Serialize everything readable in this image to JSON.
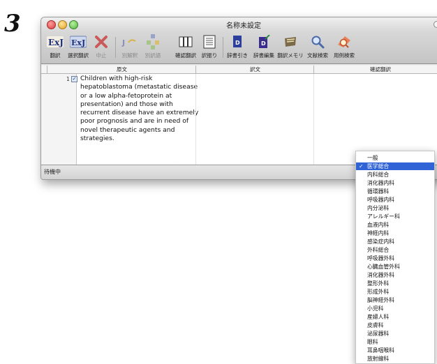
{
  "step_number": "3",
  "window": {
    "title": "名称未設定"
  },
  "toolbar": {
    "buttons": [
      {
        "label": "翻訳",
        "icon": "exj-translate-icon",
        "disabled": false
      },
      {
        "label": "選択翻訳",
        "icon": "exj-select-translate-icon",
        "disabled": false
      },
      {
        "label": "中止",
        "icon": "stop-x-icon",
        "disabled": true
      },
      {
        "label": "別解釈",
        "icon": "alt-interpretation-icon",
        "disabled": true
      },
      {
        "label": "別訳語",
        "icon": "alt-term-icon",
        "disabled": true
      },
      {
        "label": "確認翻訳",
        "icon": "confirm-translate-icon",
        "disabled": false
      },
      {
        "label": "訳振り",
        "icon": "interlinear-icon",
        "disabled": false
      },
      {
        "label": "辞書引き",
        "icon": "dictionary-lookup-icon",
        "disabled": false
      },
      {
        "label": "辞書編集",
        "icon": "dictionary-edit-icon",
        "disabled": false
      },
      {
        "label": "翻訳メモリ",
        "icon": "translation-memory-icon",
        "disabled": false
      },
      {
        "label": "文献検索",
        "icon": "literature-search-icon",
        "disabled": false
      },
      {
        "label": "用例検索",
        "icon": "example-search-icon",
        "disabled": false
      }
    ],
    "overflow": "›"
  },
  "columns": [
    "原文",
    "訳文",
    "確認翻訳"
  ],
  "rows": [
    {
      "number": "1",
      "checked": true,
      "source": "Children with high-risk hepatoblastoma (metastatic disease or a low alpha-fetoprotein at presentation) and those with recurrent disease have an extremely poor prognosis and are in need of novel therapeutic agents and strategies."
    }
  ],
  "status": {
    "text": "待機中"
  },
  "dropdown": {
    "selected": "医学総合",
    "checkmark": "✓",
    "options": [
      "一般",
      "医学総合",
      "内科総合",
      "消化器内科",
      "循環器科",
      "呼吸器内科",
      "内分泌科",
      "アレルギー科",
      "血液内科",
      "神経内科",
      "感染症内科",
      "外科総合",
      "呼吸器外科",
      "心臓血管外科",
      "消化器外科",
      "整形外科",
      "形成外科",
      "脳神経外科",
      "小児科",
      "産婦人科",
      "皮膚科",
      "泌尿器科",
      "眼科",
      "耳鼻咽喉科",
      "放射線科"
    ]
  }
}
